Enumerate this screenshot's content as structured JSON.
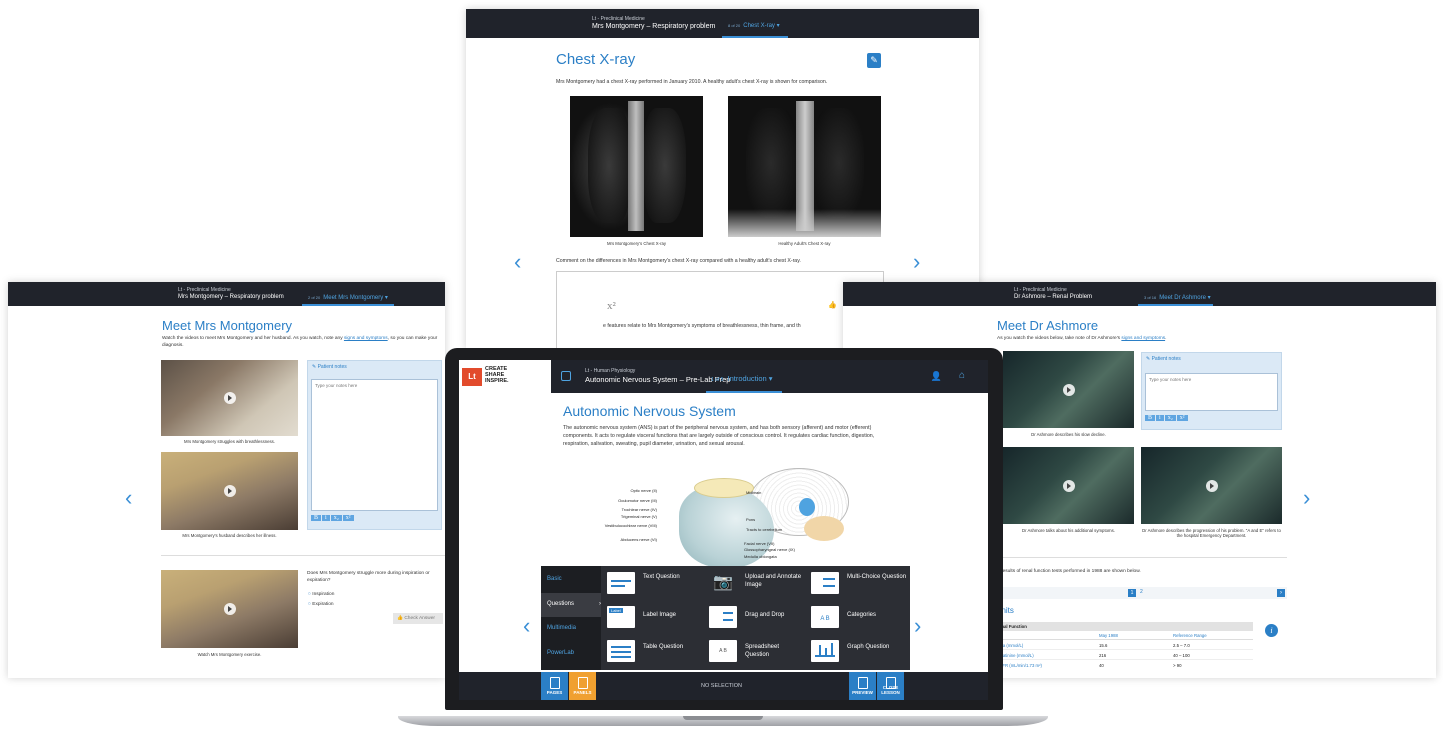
{
  "top_panel": {
    "course": "Lt - Preclinical Medicine",
    "lesson": "Mrs Montgomery – Respiratory problem",
    "page_of": "8 of 20",
    "page_title": "Chest X-ray",
    "intro": "Mrs Montgomery had a chest X-ray performed in January 2010. A healthy adult's chest X-ray is shown for comparison.",
    "caption_left": "Mrs Montgomery's Chest X-ray",
    "caption_right": "Healthy Adult's Chest X-ray",
    "prompt": "Comment on the differences in Mrs Montgomery's chest X-ray compared with a healthy adult's chest X-ray.",
    "cut_text": "e features relate to Mrs Montgomery's symptoms of breathlessness, thin frame, and th"
  },
  "left_panel": {
    "course": "Lt - Preclinical Medicine",
    "lesson": "Mrs Montgomery – Respiratory problem",
    "page_of": "2 of 20",
    "page_title": "Meet Mrs Montgomery",
    "intro_a": "Watch the videos to meet Mrs Montgomery and her husband. As you watch, note any ",
    "intro_link": "signs and symptoms",
    "intro_b": ", so you can make your diagnosis.",
    "notes_title": "Patient notes",
    "notes_placeholder": "Type your notes here",
    "cap1": "Mrs Montgomery struggles with breathlessness.",
    "cap2": "Mrs Montgomery's husband describes her illness.",
    "cap3": "Watch Mrs Montgomery exercise.",
    "question": "Does Mrs Montgomery struggle more during inspiration or expiration?",
    "option1": "Inspiration",
    "option2": "Expiration",
    "check": "Check Answer"
  },
  "right_panel": {
    "course": "Lt - Preclinical Medicine",
    "lesson": "Dr Ashmore – Renal Problem",
    "page_of": "3 of 16",
    "page_title": "Meet Dr Ashmore",
    "intro_a": "As you watch the videos below, take note of Dr Ashmore's ",
    "intro_link": "signs and symptoms",
    "notes_title": "Patient notes",
    "notes_placeholder": "Type your notes here",
    "cap1": "Dr Ashmore describes his slow decline.",
    "cap2": "Dr Ashmore talks about his additional symptoms.",
    "cap3": "Dr Ashmore describes the progression of his problem. \"A and E\" refers to the hospital Emergency Department.",
    "results_text": "e results of renal function tests performed in 1988 are shown below.",
    "page1": "1",
    "page2": "2",
    "units": "units",
    "table_head": "enal Function",
    "col1": "May 1988",
    "col2": "Reference Range",
    "rows": [
      {
        "name": "rea (mmol/L)",
        "v": "15.6",
        "r": "2.5 – 7.0"
      },
      {
        "name": "reatinine (mmol/L)",
        "v": "216",
        "r": "40 – 100"
      },
      {
        "name": "GFR (mL/min/1.73 m²)",
        "v": "40",
        "r": "> 90"
      }
    ]
  },
  "laptop": {
    "logo": "Lt",
    "tagline": [
      "CREATE",
      "SHARE",
      "INSPIRE."
    ],
    "course": "Lt - Human Physiology",
    "lesson": "Autonomic Nervous System – Pre-Lab Prep",
    "page_of": "1 of 5",
    "section": "Introduction",
    "page_title": "Autonomic Nervous System",
    "body": "The autonomic nervous system (ANS) is part of the peripheral nervous system, and has both sensory (afferent) and motor (efferent) components. It acts to regulate visceral functions that are largely outside of conscious control. It regulates cardiac function, digestion, respiration, salivation, sweating, pupil diameter, urination, and sexual arousal.",
    "labels_left": [
      "Optic nerve (II)",
      "Oculomotor nerve (III)",
      "Trochlear nerve (IV)",
      "Trigeminal nerve (V)",
      "Vestibulocochlear nerve (VIII)",
      "Abducens nerve (VI)"
    ],
    "labels_right": [
      "Midbrain",
      "Pons",
      "Tracts to cerebellum",
      "Facial nerve (VII)",
      "Glossopharyngeal nerve (IX)",
      "Medulla oblongata"
    ],
    "menu": [
      "Basic",
      "Questions",
      "Multimedia",
      "PowerLab"
    ],
    "items": [
      "Text Question",
      "Upload and Annotate Image",
      "Multi-Choice Question",
      "Label Image",
      "Drag and Drop",
      "Categories",
      "Table Question",
      "Spreadsheet Question",
      "Graph Question"
    ],
    "label_tag": "Label",
    "no_selection": "NO SELECTION",
    "btn_pages": "PAGES",
    "btn_panels": "PANELS",
    "btn_preview": "PREVIEW",
    "btn_close": "CLOSE LESSON"
  }
}
